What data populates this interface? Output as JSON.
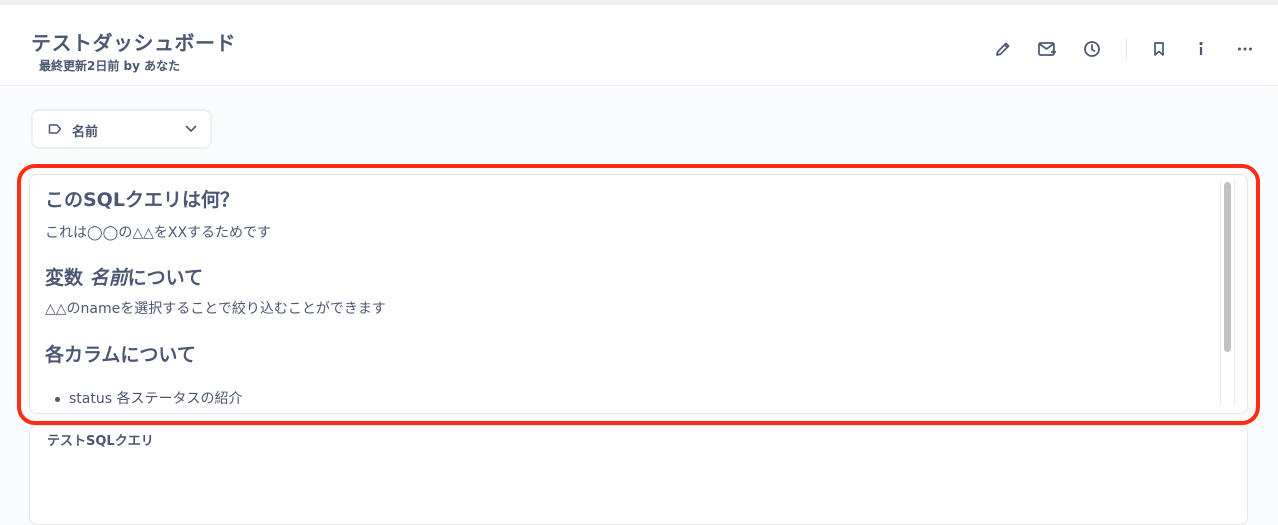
{
  "header": {
    "title": "テストダッシュボード",
    "subtitle": "最終更新2日前 by あなた",
    "actions": [
      {
        "name": "edit",
        "icon": "pencil-icon"
      },
      {
        "name": "subscriptions",
        "icon": "mail-add-icon"
      },
      {
        "name": "history",
        "icon": "clock-icon"
      },
      {
        "name": "bookmark",
        "icon": "bookmark-icon"
      },
      {
        "name": "info",
        "icon": "info-icon"
      },
      {
        "name": "more",
        "icon": "ellipsis-icon"
      }
    ]
  },
  "filter": {
    "label": "名前",
    "icon": "tag-icon"
  },
  "text_card": {
    "heading1": "このSQLクエリは何？",
    "para1": "これは◯◯の△△をXXするためです",
    "heading2_prefix": "変数 ",
    "heading2_em": "名前",
    "heading2_suffix": "について",
    "para2": "△△のnameを選択することで絞り込むことができます",
    "heading3": "各カラムについて",
    "list": [
      "status 各ステータスの紹介"
    ]
  },
  "query_card": {
    "title": "テストSQLクエリ"
  },
  "colors": {
    "text": "#4c5773",
    "highlight": "#ff2c16",
    "background": "#f9fbfc"
  }
}
